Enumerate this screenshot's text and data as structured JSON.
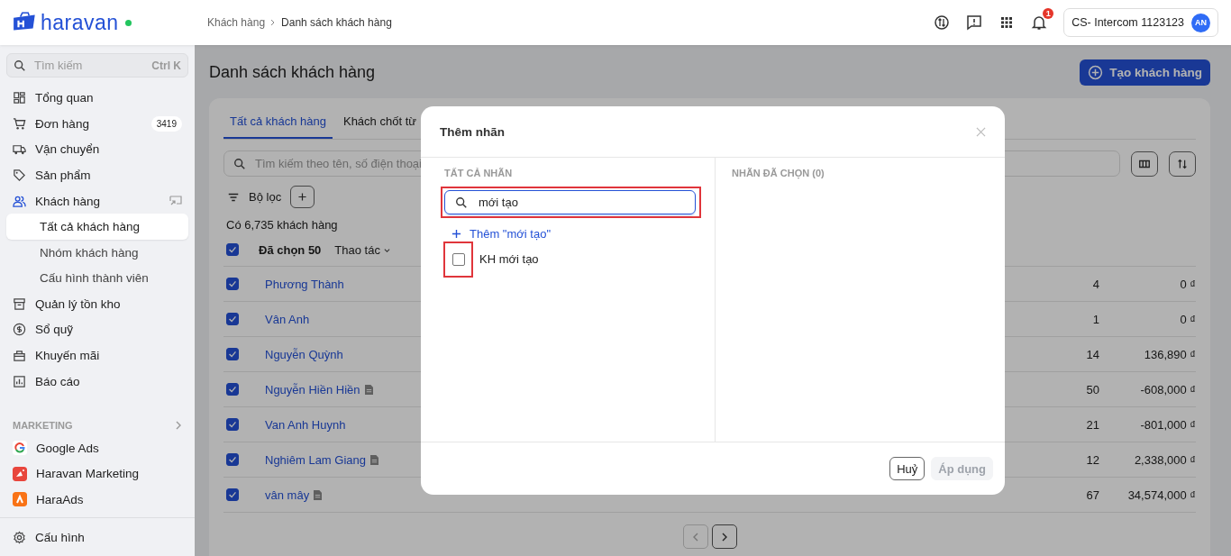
{
  "app": {
    "logo": "haravan",
    "online": true
  },
  "breadcrumb": [
    "Khách hàng",
    "Danh sách khách hàng"
  ],
  "topbar": {
    "notification_count": "1",
    "account": "CS- Intercom 1123123",
    "avatar": "AN"
  },
  "sidebar": {
    "search": {
      "placeholder": "Tìm kiếm",
      "shortcut": "Ctrl K"
    },
    "items": [
      {
        "label": "Tổng quan",
        "selected": false
      },
      {
        "label": "Đơn hàng",
        "selected": false,
        "badge": "3419"
      },
      {
        "label": "Vận chuyển",
        "selected": false
      },
      {
        "label": "Sản phẩm",
        "selected": false
      },
      {
        "label": "Khách hàng",
        "selected": true,
        "children": [
          {
            "label": "Tất cả khách hàng",
            "selected": true
          },
          {
            "label": "Nhóm khách hàng",
            "selected": false
          },
          {
            "label": "Cấu hình thành viên",
            "selected": false
          }
        ]
      },
      {
        "label": "Quản lý tồn kho",
        "selected": false
      },
      {
        "label": "Sổ quỹ",
        "selected": false
      },
      {
        "label": "Khuyến mãi",
        "selected": false
      },
      {
        "label": "Báo cáo",
        "selected": false
      }
    ],
    "section": "MARKETING",
    "apps": [
      {
        "label": "Google Ads"
      },
      {
        "label": "Haravan Marketing"
      },
      {
        "label": "HaraAds"
      }
    ],
    "footer": {
      "label": "Cấu hình"
    }
  },
  "page": {
    "title": "Danh sách khách hàng",
    "create_button": "Tạo khách hàng"
  },
  "tabs": [
    {
      "label": "Tất cả khách hàng",
      "selected": true
    },
    {
      "label": "Khách chốt từ",
      "selected": false
    }
  ],
  "search": {
    "placeholder": "Tìm kiếm theo tên, số điện thoại"
  },
  "filter": {
    "label": "Bộ lọc"
  },
  "count": "Có 6,735 khách hàng",
  "table": {
    "select_all": {
      "checked": true
    },
    "selected_label": "Đã chọn 50",
    "actions": "Thao tác",
    "rows": [
      {
        "name": "Phương Thành",
        "note": false,
        "checked": true,
        "orders": "4",
        "total": "0 ₫"
      },
      {
        "name": "Vân Anh",
        "note": false,
        "checked": true,
        "orders": "1",
        "total": "0 ₫"
      },
      {
        "name": "Nguyễn Quỳnh",
        "note": false,
        "checked": true,
        "orders": "14",
        "total": "136,890 ₫"
      },
      {
        "name": "Nguyễn Hiền Hiền",
        "note": true,
        "checked": true,
        "orders": "50",
        "total": "-608,000 ₫"
      },
      {
        "name": "Van Anh Huynh",
        "note": false,
        "checked": true,
        "orders": "21",
        "total": "-801,000 ₫"
      },
      {
        "name": "Nghiêm Lam Giang",
        "note": true,
        "checked": true,
        "orders": "12",
        "total": "2,338,000 ₫"
      },
      {
        "name": "vân mây",
        "note": true,
        "checked": true,
        "orders": "67",
        "total": "34,574,000 ₫"
      }
    ]
  },
  "modal": {
    "title": "Thêm nhãn",
    "left_heading": "TẤT CẢ NHÃN",
    "search": {
      "value": "mới tạo",
      "highlighted": true
    },
    "add_link": "Thêm \"mới tạo\"",
    "options": [
      {
        "label": "KH mới tạo",
        "checked": false,
        "highlighted": true
      }
    ],
    "right_heading": "NHÃN ĐÃ CHỌN (0)",
    "buttons": [
      {
        "label": "Huỷ",
        "disabled": false
      },
      {
        "label": "Áp dụng",
        "disabled": true
      }
    ]
  }
}
